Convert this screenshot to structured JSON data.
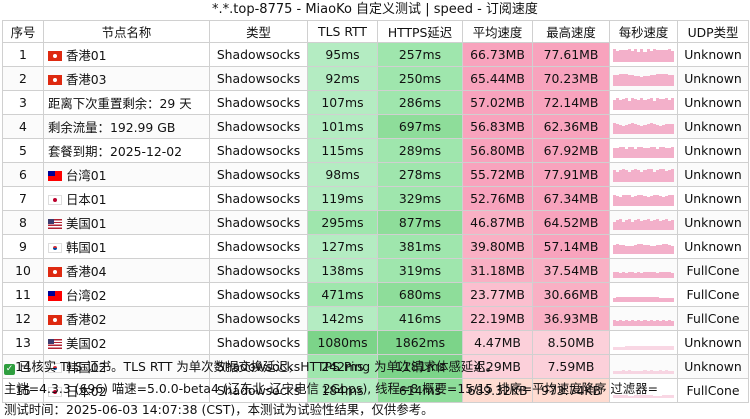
{
  "title": "*.*.top-8775 - MiaoKo 自定义测试 | speed - 订阅速度",
  "headers": [
    "序号",
    "节点名称",
    "类型",
    "TLS RTT",
    "HTTPS延迟",
    "平均速度",
    "最高速度",
    "每秒速度",
    "UDP类型"
  ],
  "rows": [
    {
      "idx": "1",
      "flag": "hk",
      "name": "香港01",
      "type": "Shadowsocks",
      "tls": "95ms",
      "https": "257ms",
      "avg": "66.73MB",
      "max": "77.61MB",
      "udp": "Unknown"
    },
    {
      "idx": "2",
      "flag": "hk",
      "name": "香港03",
      "type": "Shadowsocks",
      "tls": "92ms",
      "https": "250ms",
      "avg": "65.44MB",
      "max": "70.23MB",
      "udp": "Unknown"
    },
    {
      "idx": "3",
      "flag": "",
      "name": "距离下次重置剩余：29 天",
      "type": "Shadowsocks",
      "tls": "107ms",
      "https": "286ms",
      "avg": "57.02MB",
      "max": "72.14MB",
      "udp": "Unknown"
    },
    {
      "idx": "4",
      "flag": "",
      "name": "剩余流量：192.99 GB",
      "type": "Shadowsocks",
      "tls": "101ms",
      "https": "697ms",
      "avg": "56.83MB",
      "max": "62.36MB",
      "udp": "Unknown"
    },
    {
      "idx": "5",
      "flag": "",
      "name": "套餐到期：2025-12-02",
      "type": "Shadowsocks",
      "tls": "115ms",
      "https": "289ms",
      "avg": "56.80MB",
      "max": "67.92MB",
      "udp": "Unknown"
    },
    {
      "idx": "6",
      "flag": "tw",
      "name": "台湾01",
      "type": "Shadowsocks",
      "tls": "98ms",
      "https": "278ms",
      "avg": "55.72MB",
      "max": "77.91MB",
      "udp": "Unknown"
    },
    {
      "idx": "7",
      "flag": "jp",
      "name": "日本01",
      "type": "Shadowsocks",
      "tls": "119ms",
      "https": "329ms",
      "avg": "52.76MB",
      "max": "67.34MB",
      "udp": "Unknown"
    },
    {
      "idx": "8",
      "flag": "us",
      "name": "美国01",
      "type": "Shadowsocks",
      "tls": "295ms",
      "https": "877ms",
      "avg": "46.87MB",
      "max": "64.52MB",
      "udp": "Unknown"
    },
    {
      "idx": "9",
      "flag": "kr",
      "name": "韩国01",
      "type": "Shadowsocks",
      "tls": "127ms",
      "https": "381ms",
      "avg": "39.80MB",
      "max": "57.14MB",
      "udp": "Unknown"
    },
    {
      "idx": "10",
      "flag": "hk",
      "name": "香港04",
      "type": "Shadowsocks",
      "tls": "138ms",
      "https": "319ms",
      "avg": "31.18MB",
      "max": "37.54MB",
      "udp": "FullCone"
    },
    {
      "idx": "11",
      "flag": "tw",
      "name": "台湾02",
      "type": "Shadowsocks",
      "tls": "471ms",
      "https": "680ms",
      "avg": "23.77MB",
      "max": "30.66MB",
      "udp": "FullCone"
    },
    {
      "idx": "12",
      "flag": "hk",
      "name": "香港02",
      "type": "Shadowsocks",
      "tls": "142ms",
      "https": "416ms",
      "avg": "22.19MB",
      "max": "36.93MB",
      "udp": "FullCone"
    },
    {
      "idx": "13",
      "flag": "us",
      "name": "美国02",
      "type": "Shadowsocks",
      "tls": "1080ms",
      "https": "1862ms",
      "avg": "4.47MB",
      "max": "8.50MB",
      "udp": "Unknown"
    },
    {
      "idx": "14",
      "flag": "kr",
      "name": "韩国02",
      "type": "Shadowsocks",
      "tls": "242ms",
      "https": "1181ms",
      "avg": "4.29MB",
      "max": "7.59MB",
      "udp": "Unknown"
    },
    {
      "idx": "15",
      "flag": "jp",
      "name": "日本02",
      "type": "Shadowsocks",
      "tls": "184ms",
      "https": "614ms",
      "avg": "689.32KB",
      "max": "973.74KB",
      "udp": "FullCone"
    }
  ],
  "footer": {
    "line1": "已核实 TLS 证书。TLS RTT 为单次数据交换延迟，HTTPS Ping 为单次请求体感延迟。",
    "line2": "主端=4.3.3 (696) 喵速=5.0.0-beta4 (辽东北-辽宁电信 2Gbps), 线程=8 概要=15/15 排序=平均速度降序 过滤器=",
    "line3": "测试时间：2025-06-03 14:07:38 (CST)，本测试为试验性结果，仅供参考。"
  },
  "colors": {
    "tls_fast": "#a8e6b8",
    "https_mid": "#95e49f",
    "avg_fast": "#f7a0b8",
    "avg_slow": "#ffd9cc",
    "spark": "#f2a7c4"
  }
}
